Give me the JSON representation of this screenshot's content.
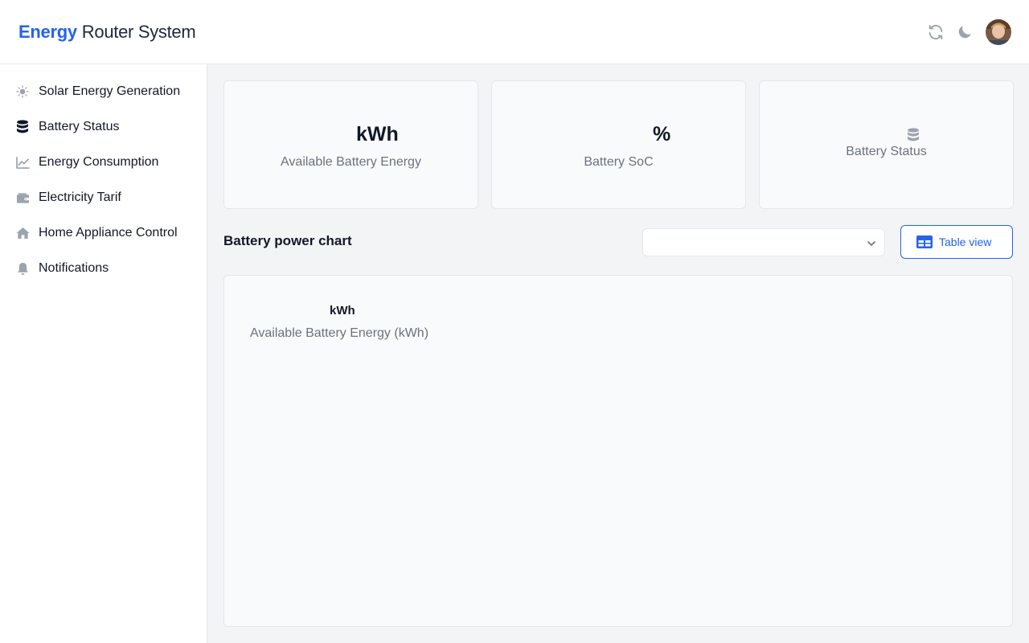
{
  "header": {
    "brand_accent": "Energy",
    "brand_rest": "Router System",
    "accent_color": "#2563eb",
    "refresh_icon": "refresh-icon",
    "theme_icon": "moon-icon"
  },
  "sidebar": {
    "items": [
      {
        "label": "Solar Energy Generation",
        "icon": "sun-icon",
        "active": false
      },
      {
        "label": "Battery Status",
        "icon": "database-icon",
        "active": true
      },
      {
        "label": "Energy Consumption",
        "icon": "line-chart-icon",
        "active": false
      },
      {
        "label": "Electricity Tarif",
        "icon": "wallet-icon",
        "active": false
      },
      {
        "label": "Home Appliance Control",
        "icon": "home-icon",
        "active": false
      },
      {
        "label": "Notifications",
        "icon": "bell-icon",
        "active": false
      }
    ]
  },
  "cards": [
    {
      "value": "kWh",
      "label": "Available Battery Energy"
    },
    {
      "value": "%",
      "label": "Battery SoC"
    },
    {
      "label": "Battery Status",
      "icon": "database-icon"
    }
  ],
  "chart_section": {
    "title": "Battery power chart",
    "select_value": "",
    "table_view_label": "Table view",
    "table_view_icon": "table-view-icon",
    "panel_unit": "kWh",
    "panel_label": "Available Battery Energy (kWh)"
  }
}
